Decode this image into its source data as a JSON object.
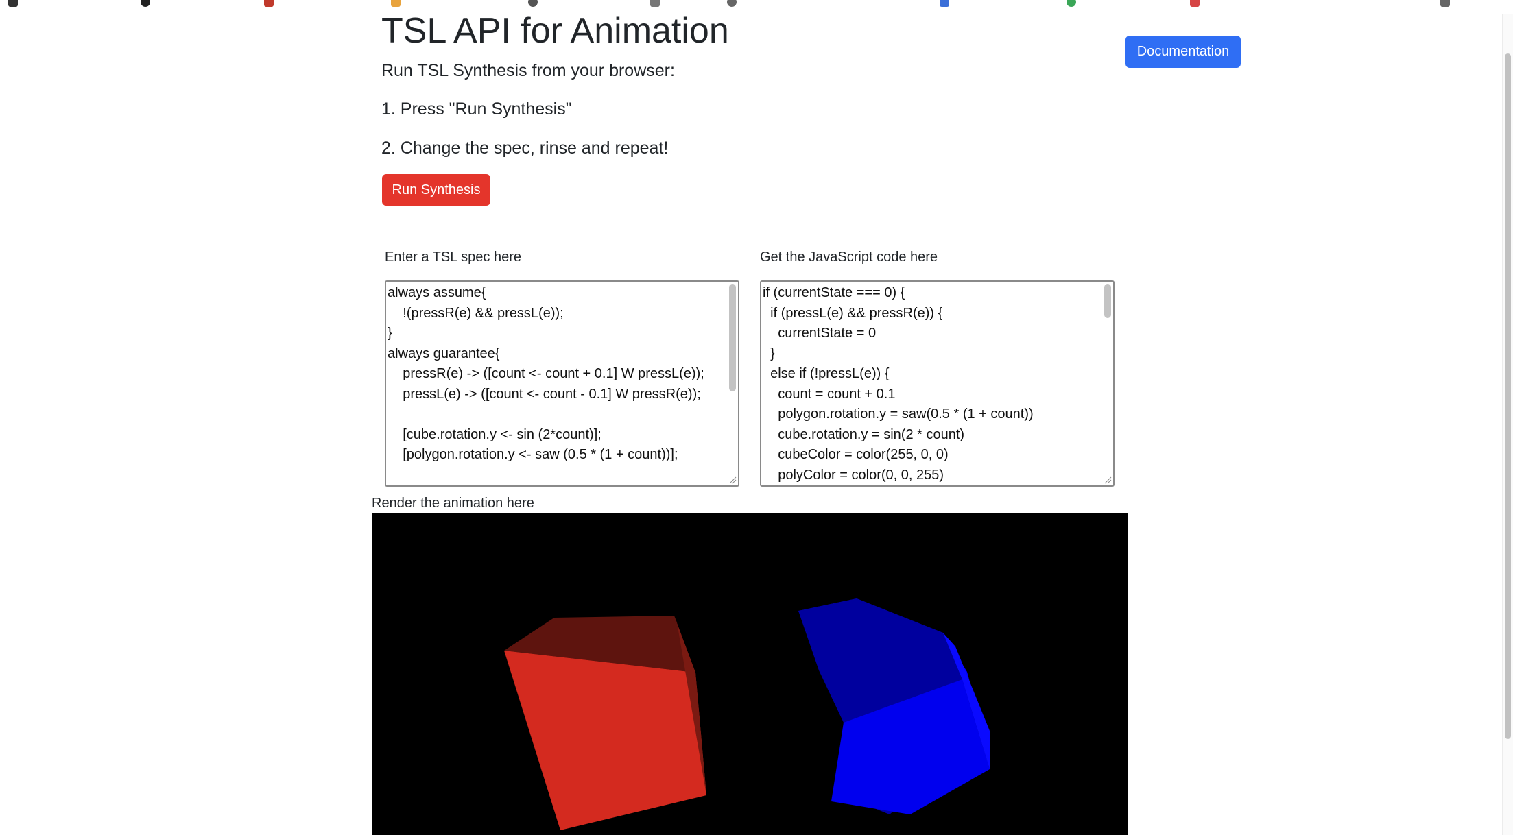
{
  "page": {
    "title": "TSL API for Animation",
    "documentation_label": "Documentation",
    "intro": "Run TSL Synthesis from your browser:",
    "step1": "1. Press \"Run Synthesis\"",
    "step2": "2. Change the spec, rinse and repeat!",
    "run_label": "Run Synthesis"
  },
  "spec_pane": {
    "label": "Enter a TSL spec here",
    "lines": [
      "always assume{",
      "    !(pressR(e) && pressL(e));",
      "}",
      "always guarantee{",
      "    pressR(e) -> ([count <- count + 0.1] W pressL(e));",
      "    pressL(e) -> ([count <- count - 0.1] W pressR(e));",
      "",
      "    [cube.rotation.y <- sin (2*count)];",
      "    [polygon.rotation.y <- saw (0.5 * (1 + count))];"
    ]
  },
  "js_pane": {
    "label": "Get the JavaScript code here",
    "lines": [
      "if (currentState === 0) {",
      "  if (pressL(e) && pressR(e)) {",
      "    currentState = 0",
      "  }",
      "  else if (!pressL(e)) {",
      "    count = count + 0.1",
      "    polygon.rotation.y = saw(0.5 * (1 + count))",
      "    cube.rotation.y = sin(2 * count)",
      "    cubeColor = color(255, 0, 0)",
      "    polyColor = color(0, 0, 255)"
    ]
  },
  "render": {
    "label": "Render the animation here"
  },
  "colors": {
    "documentation_button": "#2f6ef4",
    "run_button": "#e4352b",
    "canvas_background": "#000000",
    "cube_color": "#d42a1f",
    "polygon_color": "#0000ee"
  }
}
